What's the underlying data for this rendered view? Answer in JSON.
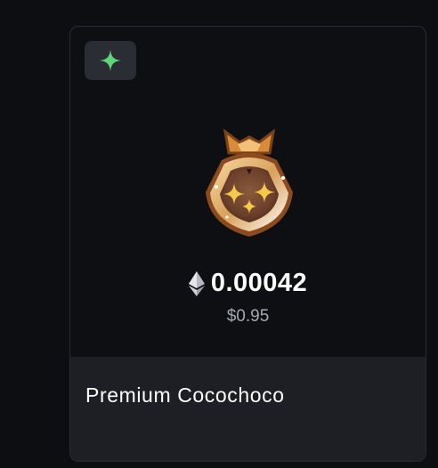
{
  "card": {
    "price": "0.00042",
    "usd_price": "$0.95",
    "name": "Premium Cocochoco",
    "badge_icon": "sparkle-icon",
    "currency_icon": "ethereum-icon",
    "image": "candy-bag-icon"
  },
  "colors": {
    "page_bg": "#0d0e12",
    "card_bg": "#0e0f13",
    "footer_bg": "#1e1f24",
    "badge_bg": "#2b2d34",
    "sparkle": "#5fd37a",
    "muted_text": "#a6a8b0"
  }
}
